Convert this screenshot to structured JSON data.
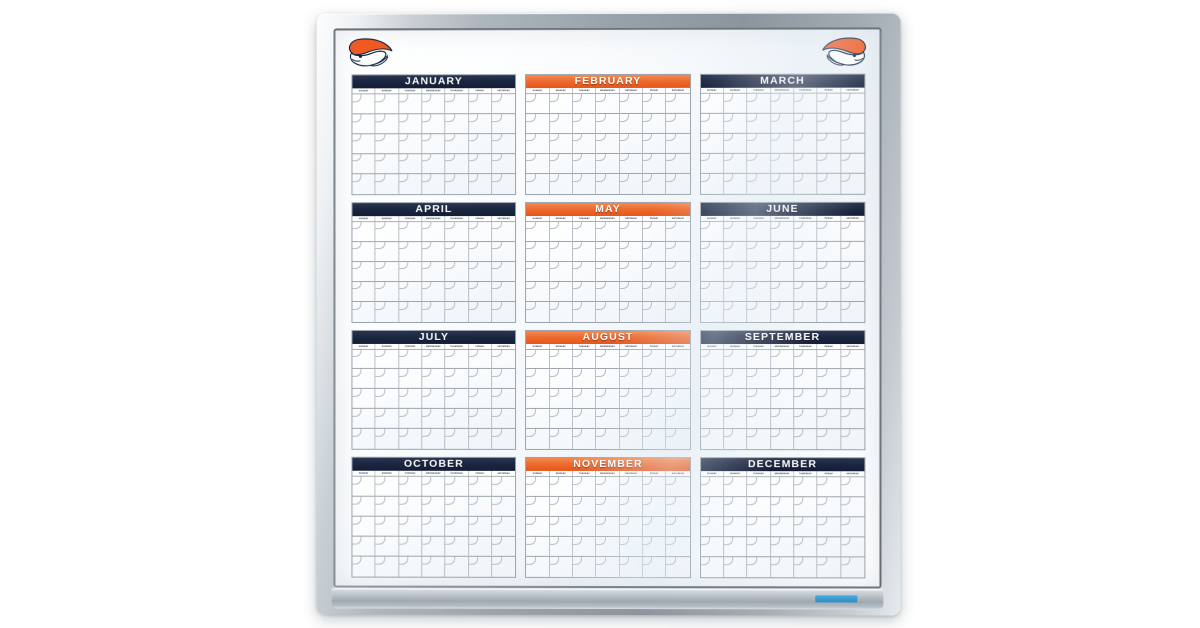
{
  "product": {
    "type": "dry-erase-yearly-wall-calendar",
    "frame_material": "aluminum",
    "team": "Denver Broncos"
  },
  "logo": {
    "name": "denver-broncos-horse-logo",
    "colors": {
      "orange": "#f05a22",
      "navy": "#0c2340",
      "white": "#ffffff"
    }
  },
  "theme": {
    "navy": "#1b2742",
    "orange": "#ef6b2d",
    "frame_silver": "#9aa3ab",
    "board_white": "#ffffff",
    "tray_accent_blue": "#2e8fc4"
  },
  "calendar": {
    "day_labels": [
      "SUNDAY",
      "MONDAY",
      "TUESDAY",
      "WEDNESDAY",
      "THURSDAY",
      "FRIDAY",
      "SATURDAY"
    ],
    "weeks_per_month": 5,
    "months": [
      {
        "name": "JANUARY",
        "color": "navy"
      },
      {
        "name": "FEBRUARY",
        "color": "orange"
      },
      {
        "name": "MARCH",
        "color": "navy"
      },
      {
        "name": "APRIL",
        "color": "navy"
      },
      {
        "name": "MAY",
        "color": "orange"
      },
      {
        "name": "JUNE",
        "color": "navy"
      },
      {
        "name": "JULY",
        "color": "navy"
      },
      {
        "name": "AUGUST",
        "color": "orange"
      },
      {
        "name": "SEPTEMBER",
        "color": "navy"
      },
      {
        "name": "OCTOBER",
        "color": "navy"
      },
      {
        "name": "NOVEMBER",
        "color": "orange"
      },
      {
        "name": "DECEMBER",
        "color": "navy"
      }
    ]
  }
}
